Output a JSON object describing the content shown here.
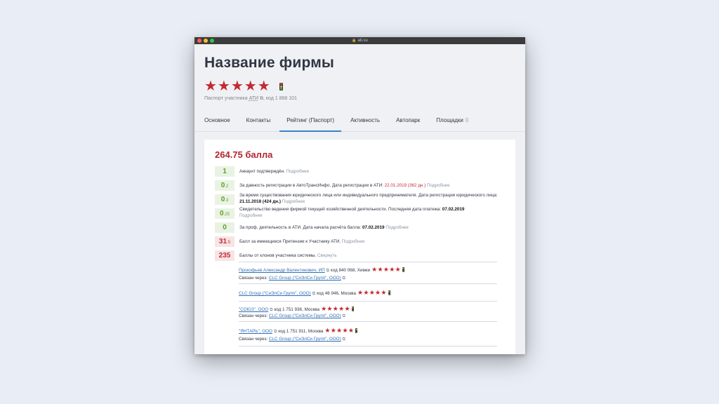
{
  "browser": {
    "url": "ati.su"
  },
  "header": {
    "company_name": "Название фирмы",
    "stars": "★★★★★",
    "passport_prefix": "Паспорт участника",
    "passport_ati": "АТИ",
    "passport_code": ", код 1 868 101"
  },
  "tabs": [
    {
      "label": "Основное"
    },
    {
      "label": "Контакты"
    },
    {
      "label": "Рейтинг (Паспорт)"
    },
    {
      "label": "Активность"
    },
    {
      "label": "Автопарк"
    },
    {
      "label": "Площадки",
      "count": "0"
    }
  ],
  "rating": {
    "total": "264.75 балла",
    "more_label": "Подробнее",
    "collapse_label": "Свернуть",
    "rows": [
      {
        "badge_main": "1",
        "badge_frac": "",
        "text": "Аккаунт подтверждён."
      },
      {
        "badge_main": "0",
        "badge_frac": ".2",
        "text": "За давность регистрации в АвтоТрансИнфо. Дата регистрации в АТИ:",
        "date": "22.01.2019 (362 дн.)"
      },
      {
        "badge_main": "0",
        "badge_frac": ".3",
        "text": "За время существования юридического лица или индивидуального предпринимателя. Дата регистрации юридического лица:",
        "date": "21.11.2018 (424 дн.)"
      },
      {
        "badge_main": "0",
        "badge_frac": ".25",
        "text": "Свидетельство ведения фирмой текущей хозяйственной деятельности. Последняя дата платежа:",
        "date": "07.02.2019"
      },
      {
        "badge_main": "0",
        "badge_frac": "",
        "text": "За проф. деятельность в АТИ. Дата начала расчёта балла:",
        "date": "07.02.2019"
      },
      {
        "badge_main": "31",
        "badge_frac": ".5",
        "text": "Балл за имеющиеся Претензии к Участнику АТИ."
      },
      {
        "badge_main": "235",
        "badge_frac": "",
        "text": "Баллы от клонов участника системы."
      }
    ]
  },
  "clones": [
    {
      "name": "Прокофьев Александр Валентинович, ИП",
      "info": "код 840 068, Химки",
      "stars": "★★★★★",
      "via_label": "Связан через:",
      "via": "CLC Group (\"СиЭлСи Групп\", ООО)"
    },
    {
      "name": "CLC Group (\"СиЭлСи Групп\", ООО)",
      "info": "код 46 946, Москва",
      "stars": "★★★★★",
      "via_label": "",
      "via": ""
    },
    {
      "name": "\"СОЮЗ\", ООО",
      "info": "код 1 751 936, Москва",
      "stars": "★★★★★",
      "via_label": "Связан через:",
      "via": "CLC Group (\"СиЭлСи Групп\", ООО)"
    },
    {
      "name": "\"ЯНТАРЬ\", ООО",
      "info": "код 1 751 911, Москва",
      "stars": "★★★★★",
      "via_label": "Связан через:",
      "via": "CLC Group (\"СиЭлСи Групп\", ООО)"
    }
  ],
  "colors": {
    "accent_red": "#c32a31",
    "link_blue": "#2f6fb7",
    "tab_underline": "#3b82c9",
    "green": "#5aa12b"
  }
}
